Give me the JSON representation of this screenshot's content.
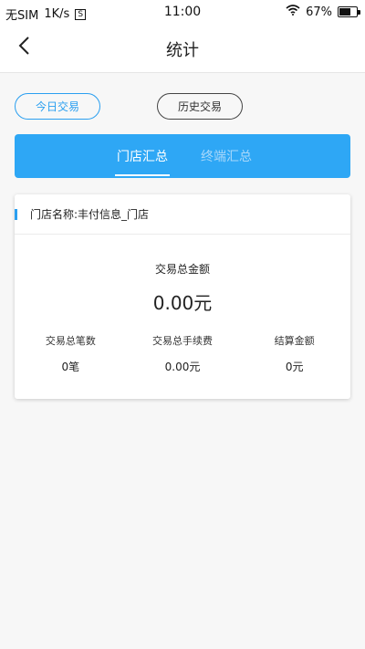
{
  "status_bar": {
    "carrier": "无SIM",
    "speed": "1K/s",
    "sim_icon_text": "S",
    "time": "11:00",
    "battery": "67%",
    "battery_level": 0.67
  },
  "nav": {
    "title": "统计",
    "back_icon": "chevron-left-icon"
  },
  "filters": {
    "today": "今日交易",
    "history": "历史交易"
  },
  "tabs": {
    "store_summary": "门店汇总",
    "terminal_summary": "终端汇总"
  },
  "card": {
    "store_name": "门店名称:丰付信息_门店",
    "total_label": "交易总金额",
    "total_value": "0.00元",
    "stats": [
      {
        "label": "交易总笔数",
        "value": "0笔"
      },
      {
        "label": "交易总手续费",
        "value": "0.00元"
      },
      {
        "label": "结算金额",
        "value": "0元"
      }
    ]
  },
  "colors": {
    "accent": "#2a9ff0",
    "tab_bar": "#2ea7f5"
  }
}
